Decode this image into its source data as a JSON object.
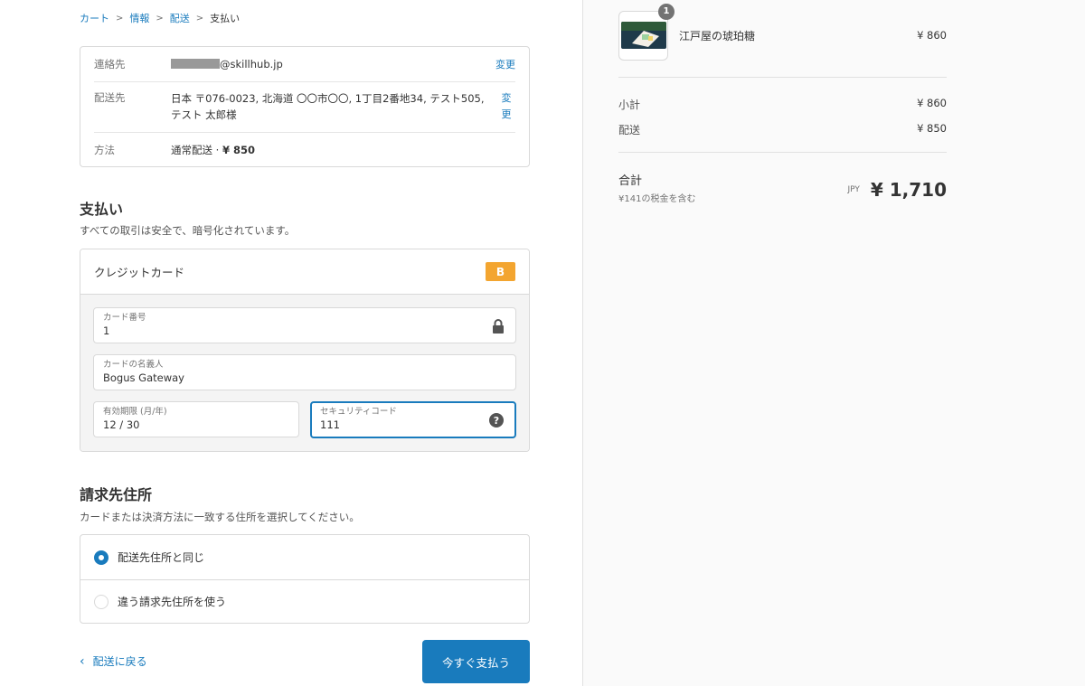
{
  "breadcrumb": [
    {
      "label": "カート",
      "link": true
    },
    {
      "label": "情報",
      "link": true
    },
    {
      "label": "配送",
      "link": true
    },
    {
      "label": "支払い",
      "link": false
    }
  ],
  "review": {
    "contact_label": "連絡先",
    "contact_value": "@skillhub.jp",
    "ship_label": "配送先",
    "ship_value": "日本 〒076-0023, 北海道 〇〇市〇〇, 1丁目2番地34, テスト505, テスト 太郎様",
    "method_label": "方法",
    "method_value": "通常配送 · ",
    "method_price": "¥ 850",
    "change_label": "変更",
    "change_label_top": "変",
    "change_label_bottom": "更"
  },
  "payment": {
    "title": "支払い",
    "subtitle": "すべての取引は安全で、暗号化されています。",
    "method": "クレジットカード",
    "badge": "B",
    "card_number_label": "カード番号",
    "card_number_value": "1",
    "name_label": "カードの名義人",
    "name_value": "Bogus Gateway",
    "expiry_label": "有効期限 (月/年)",
    "expiry_value": "12 / 30",
    "cvv_label": "セキュリティコード",
    "cvv_value": "111"
  },
  "billing": {
    "title": "請求先住所",
    "subtitle": "カードまたは決済方法に一致する住所を選択してください。",
    "options": [
      "配送先住所と同じ",
      "違う請求先住所を使う"
    ],
    "selected_index": 0
  },
  "footer": {
    "back_label": "配送に戻る",
    "pay_label": "今すぐ支払う"
  },
  "summary": {
    "item_name": "江戸屋の琥珀糖",
    "item_qty": "1",
    "item_price": "¥ 860",
    "subtotal_label": "小計",
    "subtotal_value": "¥ 860",
    "shipping_label": "配送",
    "shipping_value": "¥ 850",
    "total_label": "合計",
    "tax_note": "¥141の税金を含む",
    "currency": "JPY",
    "total_value": "¥ 1,710"
  },
  "colors": {
    "accent": "#197bbd",
    "badge": "#f3a530"
  }
}
